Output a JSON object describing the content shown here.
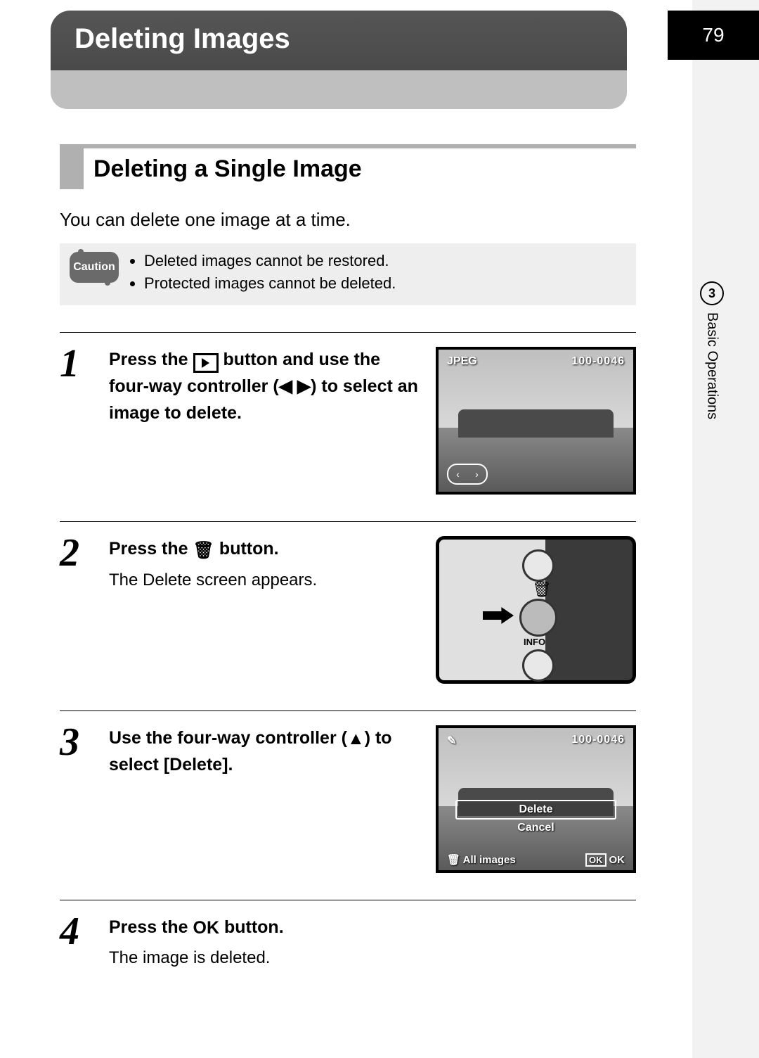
{
  "page_number": "79",
  "title": "Deleting Images",
  "subheading": "Deleting a Single Image",
  "intro": "You can delete one image at a time.",
  "caution": {
    "label": "Caution",
    "items": [
      "Deleted images cannot be restored.",
      "Protected images cannot be deleted."
    ]
  },
  "steps": {
    "s1": {
      "num": "1",
      "text_a": "Press the ",
      "text_b": " button and use the four-way controller (",
      "text_c": ") to select an image to delete.",
      "lcd": {
        "tl": "JPEG",
        "tr": "100-0046"
      }
    },
    "s2": {
      "num": "2",
      "text_a": "Press the ",
      "text_b": " button.",
      "sub": "The Delete screen appears.",
      "info_label": "INFO"
    },
    "s3": {
      "num": "3",
      "text_a": "Use the four-way controller (",
      "text_b": ") to select [Delete].",
      "lcd": {
        "tr": "100-0046",
        "menu": {
          "delete": "Delete",
          "cancel": "Cancel"
        },
        "footer": {
          "all": "All images",
          "ok": "OK",
          "ok2": "OK"
        }
      }
    },
    "s4": {
      "num": "4",
      "text_a": "Press the ",
      "text_b": " button.",
      "sub": "The image is deleted."
    }
  },
  "side_tab": {
    "num": "3",
    "label": "Basic Operations"
  }
}
